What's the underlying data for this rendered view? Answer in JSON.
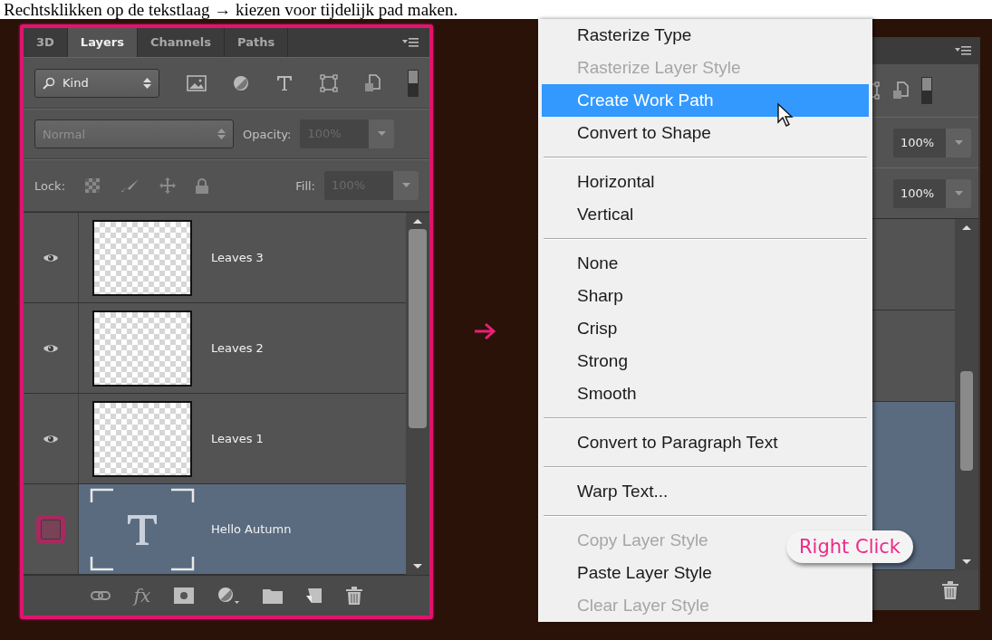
{
  "caption": "Rechtsklikken op de tekstlaag → kiezen voor tijdelijk pad maken.",
  "layers_panel": {
    "tabs": [
      {
        "label": "3D",
        "selected": false
      },
      {
        "label": "Layers",
        "selected": true
      },
      {
        "label": "Channels",
        "selected": false
      },
      {
        "label": "Paths",
        "selected": false
      }
    ],
    "filter": {
      "value": "Kind",
      "on": true
    },
    "blend_mode": {
      "value": "Normal",
      "disabled": true
    },
    "opacity": {
      "label": "Opacity:",
      "value": "100%",
      "disabled": true
    },
    "lock": {
      "label": "Lock:"
    },
    "fill": {
      "label": "Fill:",
      "value": "100%",
      "disabled": true
    },
    "layers": [
      {
        "name": "Leaves 3",
        "kind": "raster",
        "visible": true,
        "selected": false
      },
      {
        "name": "Leaves 2",
        "kind": "raster",
        "visible": true,
        "selected": false
      },
      {
        "name": "Leaves 1",
        "kind": "raster",
        "visible": true,
        "selected": false
      },
      {
        "name": "Hello Autumn",
        "kind": "text",
        "visible": false,
        "selected": true
      }
    ],
    "style_button": "fx"
  },
  "context_menu": {
    "groups": [
      [
        {
          "label": "Rasterize Type",
          "disabled": false,
          "selected": false
        },
        {
          "label": "Rasterize Layer Style",
          "disabled": true,
          "selected": false
        },
        {
          "label": "Create Work Path",
          "disabled": false,
          "selected": true
        },
        {
          "label": "Convert to Shape",
          "disabled": false,
          "selected": false
        }
      ],
      [
        {
          "label": "Horizontal",
          "disabled": false,
          "selected": false
        },
        {
          "label": "Vertical",
          "disabled": false,
          "selected": false
        }
      ],
      [
        {
          "label": "None",
          "disabled": false,
          "selected": false
        },
        {
          "label": "Sharp",
          "disabled": false,
          "selected": false
        },
        {
          "label": "Crisp",
          "disabled": false,
          "selected": false
        },
        {
          "label": "Strong",
          "disabled": false,
          "selected": false
        },
        {
          "label": "Smooth",
          "disabled": false,
          "selected": false
        }
      ],
      [
        {
          "label": "Convert to Paragraph Text",
          "disabled": false,
          "selected": false
        }
      ],
      [
        {
          "label": "Warp Text...",
          "disabled": false,
          "selected": false
        }
      ],
      [
        {
          "label": "Copy Layer Style",
          "disabled": true,
          "selected": false
        },
        {
          "label": "Paste Layer Style",
          "disabled": false,
          "selected": false
        },
        {
          "label": "Clear Layer Style",
          "disabled": true,
          "selected": false
        }
      ]
    ]
  },
  "back_panel": {
    "filter_on": true,
    "opacity_value": "100%",
    "fill_value": "100%",
    "rows": [
      {
        "selected": false
      },
      {
        "selected": false
      },
      {
        "selected": true
      }
    ]
  },
  "callout": {
    "label": "Right Click"
  }
}
